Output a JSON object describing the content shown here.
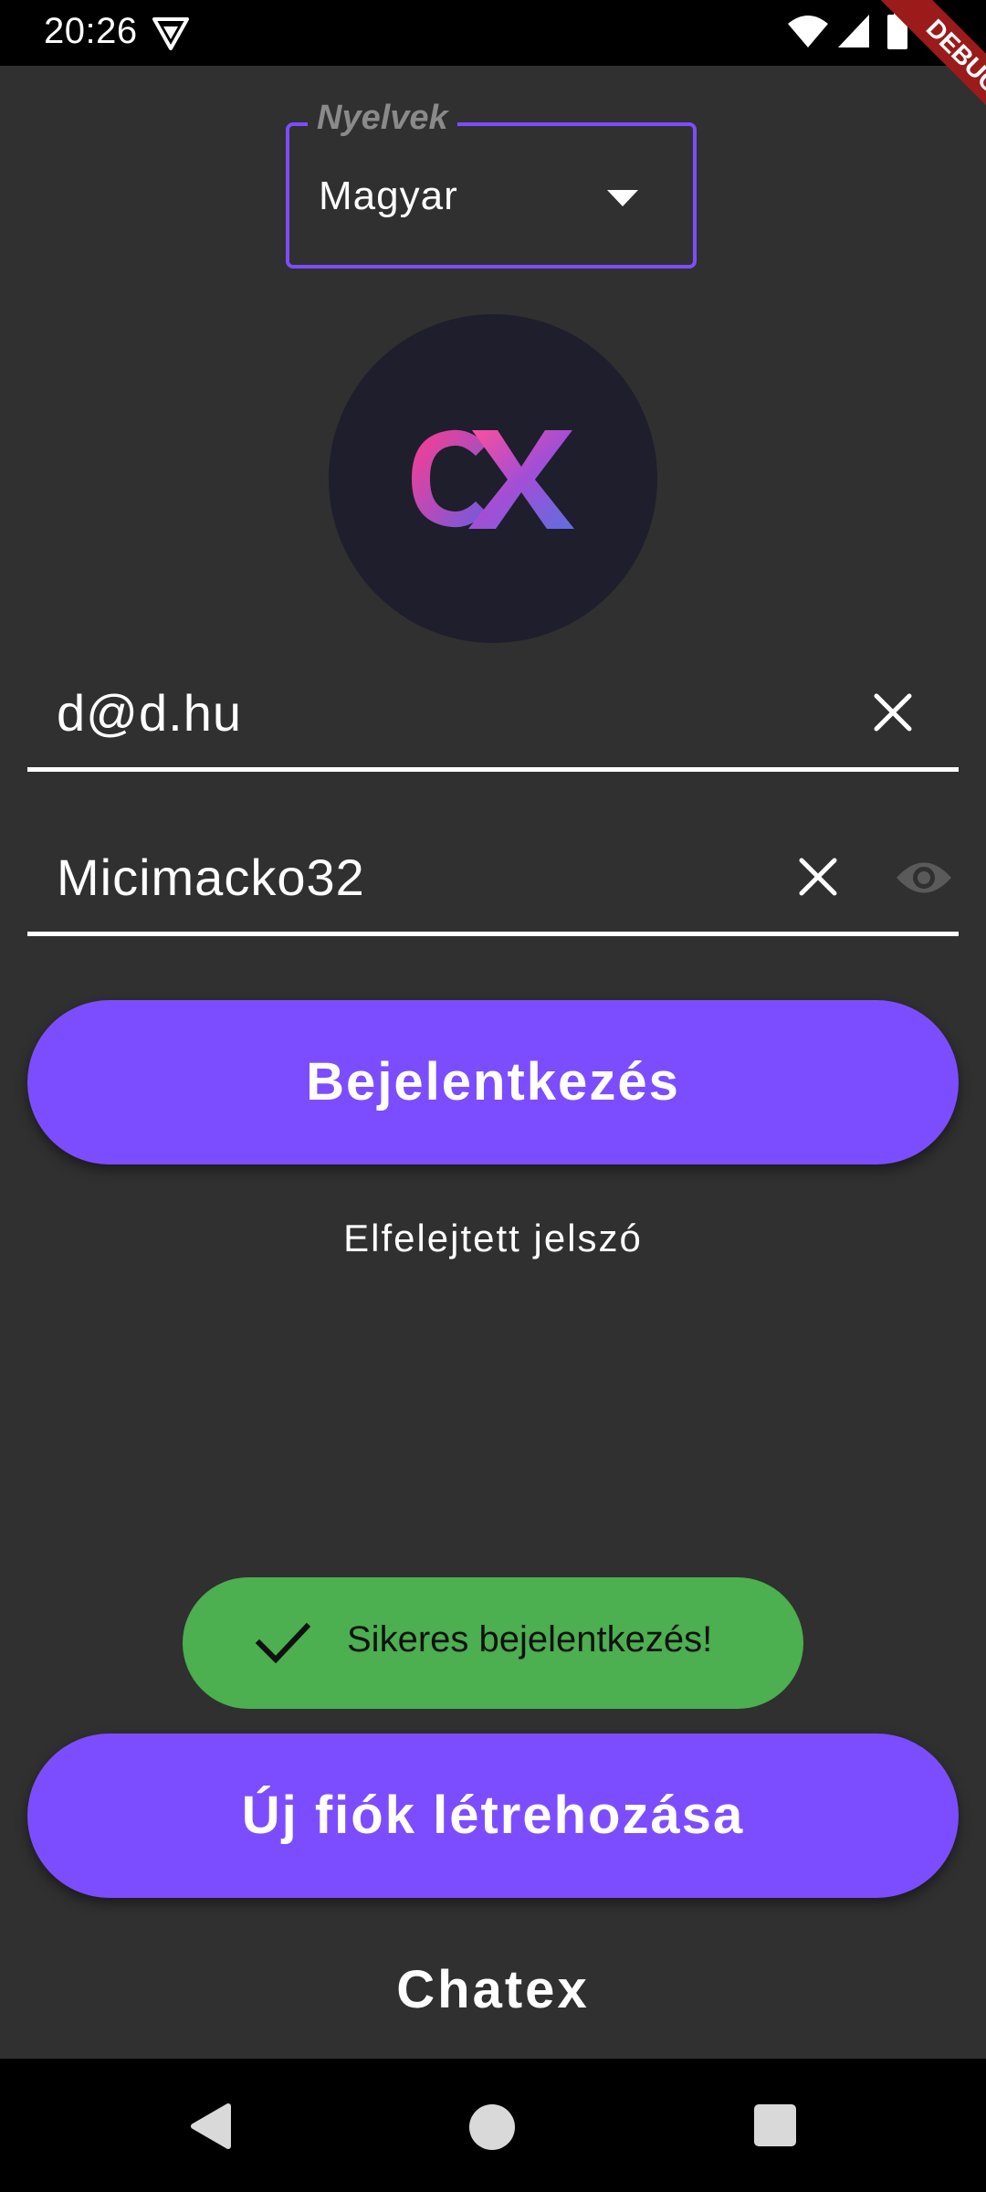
{
  "status_bar": {
    "time": "20:26",
    "debug_label": "DEBUG"
  },
  "language_selector": {
    "label": "Nyelvek",
    "value": "Magyar"
  },
  "login_form": {
    "email_value": "d@d.hu",
    "password_value": "Micimacko32",
    "login_button": "Bejelentkezés",
    "forgot_password": "Elfelejtett jelszó"
  },
  "snackbar": {
    "message": "Sikeres bejelentkezés!",
    "color": "#4caf50"
  },
  "register_button": "Új fiók létrehozása",
  "app_name": "Chatex",
  "colors": {
    "accent": "#7c4dff",
    "background": "#303030",
    "logo_circle": "#1e1e2c"
  }
}
